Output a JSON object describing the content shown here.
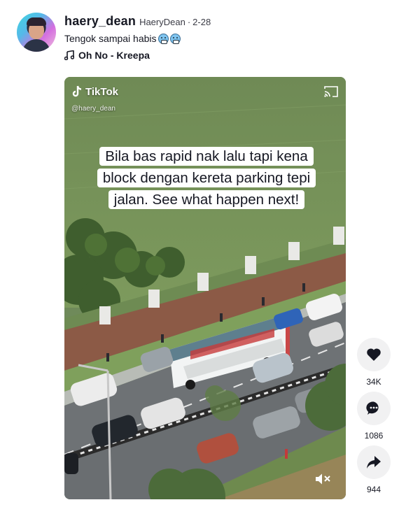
{
  "post": {
    "username": "haery_dean",
    "nickname": "HaeryDean",
    "separator": "·",
    "date": "2-28",
    "caption": "Tengok sampai habis",
    "music": "Oh No - Kreepa"
  },
  "video": {
    "brand": "TikTok",
    "handle": "@haery_dean",
    "overlay_text": "Bila bas rapid nak lalu tapi kena block dengan kereta parking tepi jalan. See what happen next!",
    "muted": true
  },
  "actions": {
    "likes": "34K",
    "comments": "1086",
    "shares": "944"
  },
  "icons": [
    "heart-icon",
    "comment-icon",
    "share-icon",
    "music-note-icon",
    "tiktok-logo-icon",
    "cast-icon",
    "mute-icon",
    "scared-face-emoji"
  ]
}
